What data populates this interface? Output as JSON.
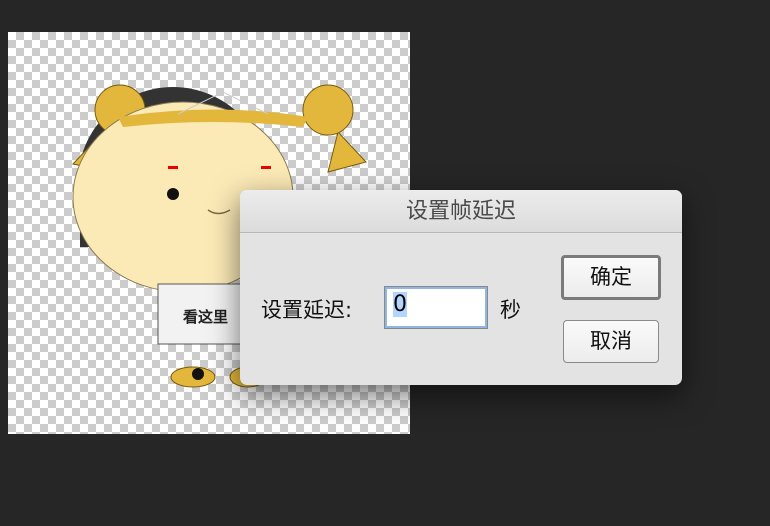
{
  "canvas": {
    "sign_text": "看这里"
  },
  "dialog": {
    "title": "设置帧延迟",
    "delay_label": "设置延迟:",
    "delay_value": "0",
    "unit_label": "秒",
    "ok_label": "确定",
    "cancel_label": "取消"
  }
}
